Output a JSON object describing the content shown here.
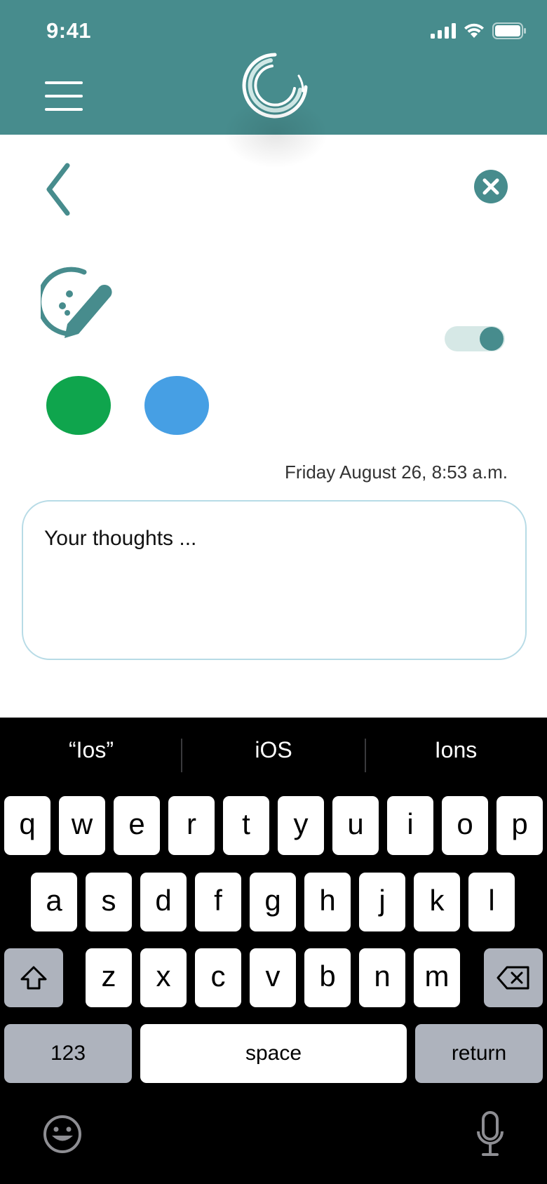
{
  "status_bar": {
    "time": "9:41"
  },
  "header": {
    "menu_icon": "hamburger-icon",
    "logo": "app-logo",
    "accent": "#478c8d"
  },
  "content": {
    "back_icon": "chevron-left-icon",
    "close_icon": "close-icon",
    "mood_icon": "mood-edit-icon",
    "toggle_on": true,
    "colors": [
      "#0fa54d",
      "#469fe4"
    ],
    "date": "Friday August 26, 8:53 a.m.",
    "thoughts_placeholder": "Your thoughts ...",
    "thoughts_value": ""
  },
  "keyboard": {
    "suggestions": [
      "“Ios”",
      "iOS",
      "Ions"
    ],
    "row1": [
      "q",
      "w",
      "e",
      "r",
      "t",
      "y",
      "u",
      "i",
      "o",
      "p"
    ],
    "row2": [
      "a",
      "s",
      "d",
      "f",
      "g",
      "h",
      "j",
      "k",
      "l"
    ],
    "row3": [
      "z",
      "x",
      "c",
      "v",
      "b",
      "n",
      "m"
    ],
    "numbers_label": "123",
    "space_label": "space",
    "return_label": "return"
  }
}
